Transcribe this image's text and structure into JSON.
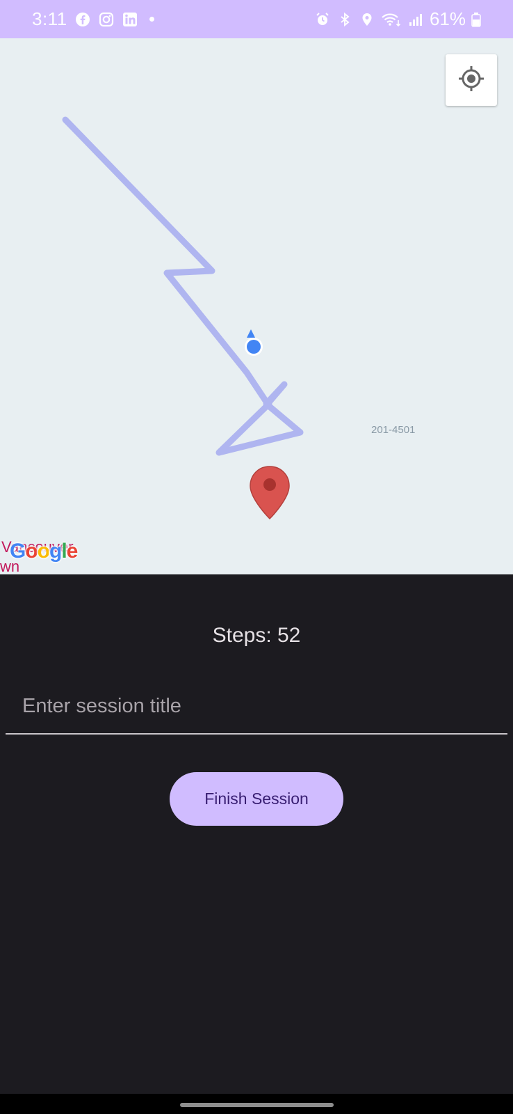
{
  "status_bar": {
    "time": "3:11",
    "app_icons": [
      "facebook-icon",
      "instagram-icon",
      "linkedin-icon"
    ],
    "system_icons": [
      "alarm-icon",
      "bluetooth-icon",
      "location-icon",
      "wifi-icon",
      "signal-icon"
    ],
    "battery": "61%",
    "background": "#d1bcff"
  },
  "map": {
    "address_label": "201-4501",
    "place_fragment_top": "Vancouver",
    "place_fragment_bottom": "wn",
    "logo_letters": [
      "G",
      "o",
      "o",
      "g",
      "l",
      "e"
    ],
    "logo_colors": [
      "#4285f4",
      "#ea4335",
      "#fbbc05",
      "#4285f4",
      "#34a853",
      "#ea4335"
    ],
    "route_color": "#a9aef0",
    "user_dot_color": "#4285f4",
    "pin_color": "#d9534f"
  },
  "session": {
    "steps_text": "Steps: 52",
    "title_placeholder": "Enter session title",
    "finish_label": "Finish Session"
  },
  "colors": {
    "accent": "#d0bcff",
    "background": "#1c1b20"
  }
}
